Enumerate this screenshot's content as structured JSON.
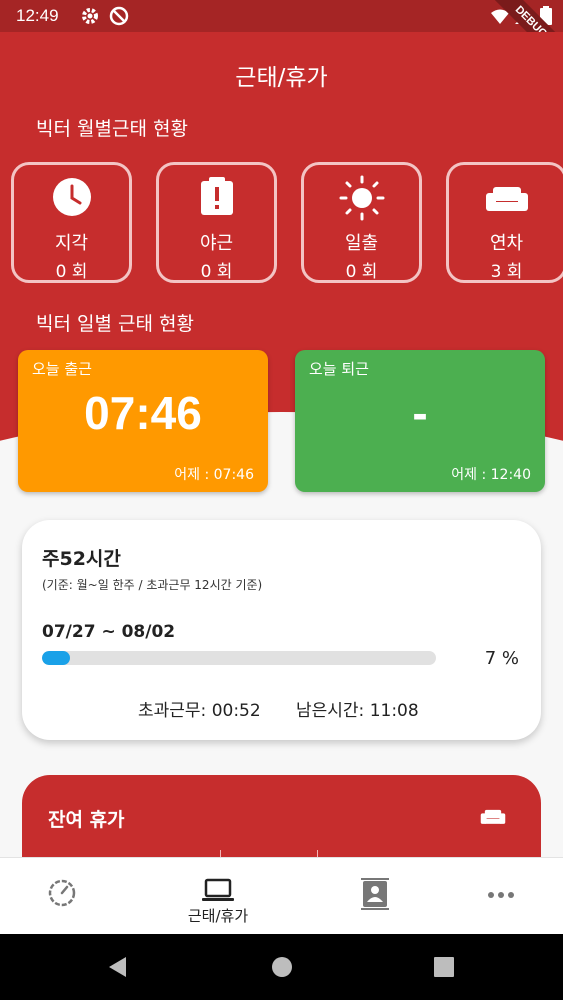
{
  "status_bar": {
    "time": "12:49",
    "debug_label": "DEBUG"
  },
  "header": {
    "title": "근태/휴가"
  },
  "monthly": {
    "section_title": "빅터 월별근태 현황",
    "items": [
      {
        "icon": "clock-icon",
        "label": "지각",
        "count": "0 회"
      },
      {
        "icon": "alert-badge-icon",
        "label": "야근",
        "count": "0 회"
      },
      {
        "icon": "sun-icon",
        "label": "일출",
        "count": "0 회"
      },
      {
        "icon": "sofa-icon",
        "label": "연차",
        "count": "3 회"
      }
    ]
  },
  "daily": {
    "section_title": "빅터 일별 근태 현황",
    "checkin": {
      "label": "오늘 출근",
      "time": "07:46",
      "previous": "어제 : 07:46",
      "color": "#ff9900"
    },
    "checkout": {
      "label": "오늘 퇴근",
      "time": "-",
      "previous": "어제 : 12:40",
      "color": "#4caf50"
    }
  },
  "weekly": {
    "title": "주52시간",
    "subtitle": "(기준: 월~일 한주 / 초과근무 12시간 기준)",
    "range": "07/27 ~ 08/02",
    "progress_percent": 7,
    "percent_label": "7 %",
    "overtime": "초과근무: 00:52",
    "remaining": "남은시간: 11:08"
  },
  "leave": {
    "title": "잔여 휴가"
  },
  "bottom_nav": [
    {
      "icon": "speedometer-icon",
      "label": ""
    },
    {
      "icon": "laptop-icon",
      "label": "근태/휴가"
    },
    {
      "icon": "contacts-icon",
      "label": ""
    },
    {
      "icon": "more-icon",
      "label": ""
    }
  ],
  "colors": {
    "primary": "#c62d2d",
    "status_bar": "#a52525",
    "checkin": "#ff9900",
    "checkout": "#4caf50",
    "progress": "#1aa1e8"
  }
}
